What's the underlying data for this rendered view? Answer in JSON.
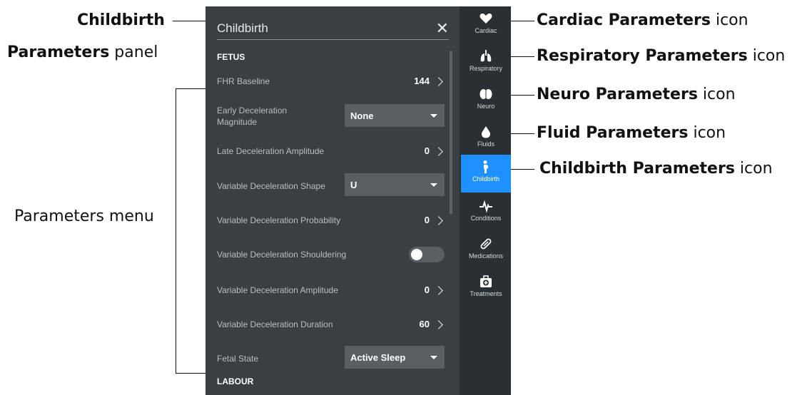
{
  "callouts": {
    "childbirth_panel_line1": "Childbirth",
    "childbirth_panel_line2_bold": "Parameters",
    "childbirth_panel_line2_rest": " panel",
    "parameters_menu": "Parameters menu",
    "cardiac_bold": "Cardiac Parameters",
    "respiratory_bold": "Respiratory Parameters",
    "neuro_bold": "Neuro Parameters",
    "fluid_bold": "Fluid Parameters",
    "childbirth_bold": "Childbirth Parameters",
    "icon_suffix": " icon"
  },
  "panel": {
    "title": "Childbirth",
    "close": "✕",
    "section_fetus": "FETUS",
    "section_labour": "LABOUR",
    "rows": [
      {
        "label": "FHR Baseline",
        "value": "144"
      },
      {
        "label": "Early Deceleration Magnitude",
        "value": "None"
      },
      {
        "label": "Late Deceleration Amplitude",
        "value": "0"
      },
      {
        "label": "Variable Deceleration Shape",
        "value": "U"
      },
      {
        "label": "Variable Deceleration Probability",
        "value": "0"
      },
      {
        "label": "Variable Deceleration Shouldering",
        "value": ""
      },
      {
        "label": "Variable Deceleration Amplitude",
        "value": "0"
      },
      {
        "label": "Variable Deceleration Duration",
        "value": "60"
      },
      {
        "label": "Fetal State",
        "value": "Active Sleep"
      }
    ]
  },
  "sidebar": {
    "items": [
      {
        "label": "Cardiac",
        "icon": "heart-icon"
      },
      {
        "label": "Respiratory",
        "icon": "lungs-icon"
      },
      {
        "label": "Neuro",
        "icon": "brain-icon"
      },
      {
        "label": "Fluids",
        "icon": "drop-icon"
      },
      {
        "label": "Childbirth",
        "icon": "pregnant-icon",
        "active": true
      },
      {
        "label": "Conditions",
        "icon": "pulse-icon"
      },
      {
        "label": "Medications",
        "icon": "pill-icon"
      },
      {
        "label": "Treatments",
        "icon": "medkit-icon"
      }
    ]
  },
  "colors": {
    "accent": "#1e90ff",
    "panel_bg": "#3a3f44",
    "sidebar_bg": "#2a2f33"
  }
}
